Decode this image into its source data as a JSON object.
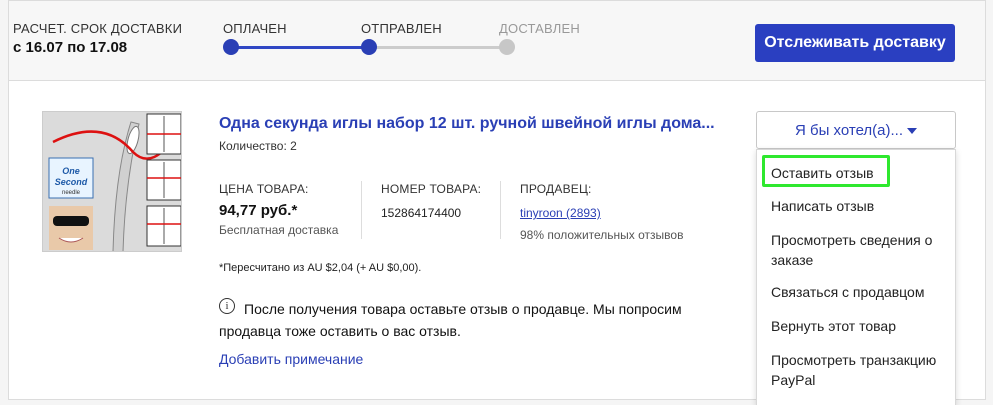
{
  "delivery": {
    "eta_label": "РАСЧЕТ. СРОК ДОСТАВКИ",
    "eta_value": "с 16.07 по 17.08",
    "steps": [
      {
        "label": "ОПЛАЧЕН",
        "state": "done"
      },
      {
        "label": "ОТПРАВЛЕН",
        "state": "done"
      },
      {
        "label": "ДОСТАВЛЕН",
        "state": "pending"
      }
    ],
    "track_button": "Отслеживать доставку"
  },
  "item": {
    "title": "Одна секунда иглы набор 12 шт. ручной швейной иглы дома...",
    "quantity": "Количество: 2",
    "price_label": "ЦЕНА ТОВАРА:",
    "price": "94,77 руб.*",
    "shipping": "Бесплатная доставка",
    "number_label": "НОМЕР ТОВАРА:",
    "number": "152864174400",
    "seller_label": "ПРОДАВЕЦ:",
    "seller": "tinyroon (2893)",
    "seller_rating": "98% положительных отзывов",
    "conversion_note": "*Пересчитано из AU $2,04 (+ AU $0,00).",
    "image_brand": "One Second needle"
  },
  "notice": {
    "line1": "После получения товара оставьте отзыв о продавце. Мы попросим",
    "line2": "продавца тоже оставить о вас отзыв."
  },
  "add_note": "Добавить примечание",
  "actions": {
    "button_label": "Я бы хотел(а)...",
    "menu": [
      "Оставить отзыв",
      "Написать отзыв",
      "Просмотреть сведения о заказе",
      "Связаться с продавцом",
      "Вернуть этот товар",
      "Просмотреть транзакцию PayPal"
    ],
    "highlighted_item": "Оставить отзыв"
  },
  "colors": {
    "accent": "#2a3fc1",
    "highlight": "#2ee82e",
    "pending": "#c7c7c7"
  }
}
